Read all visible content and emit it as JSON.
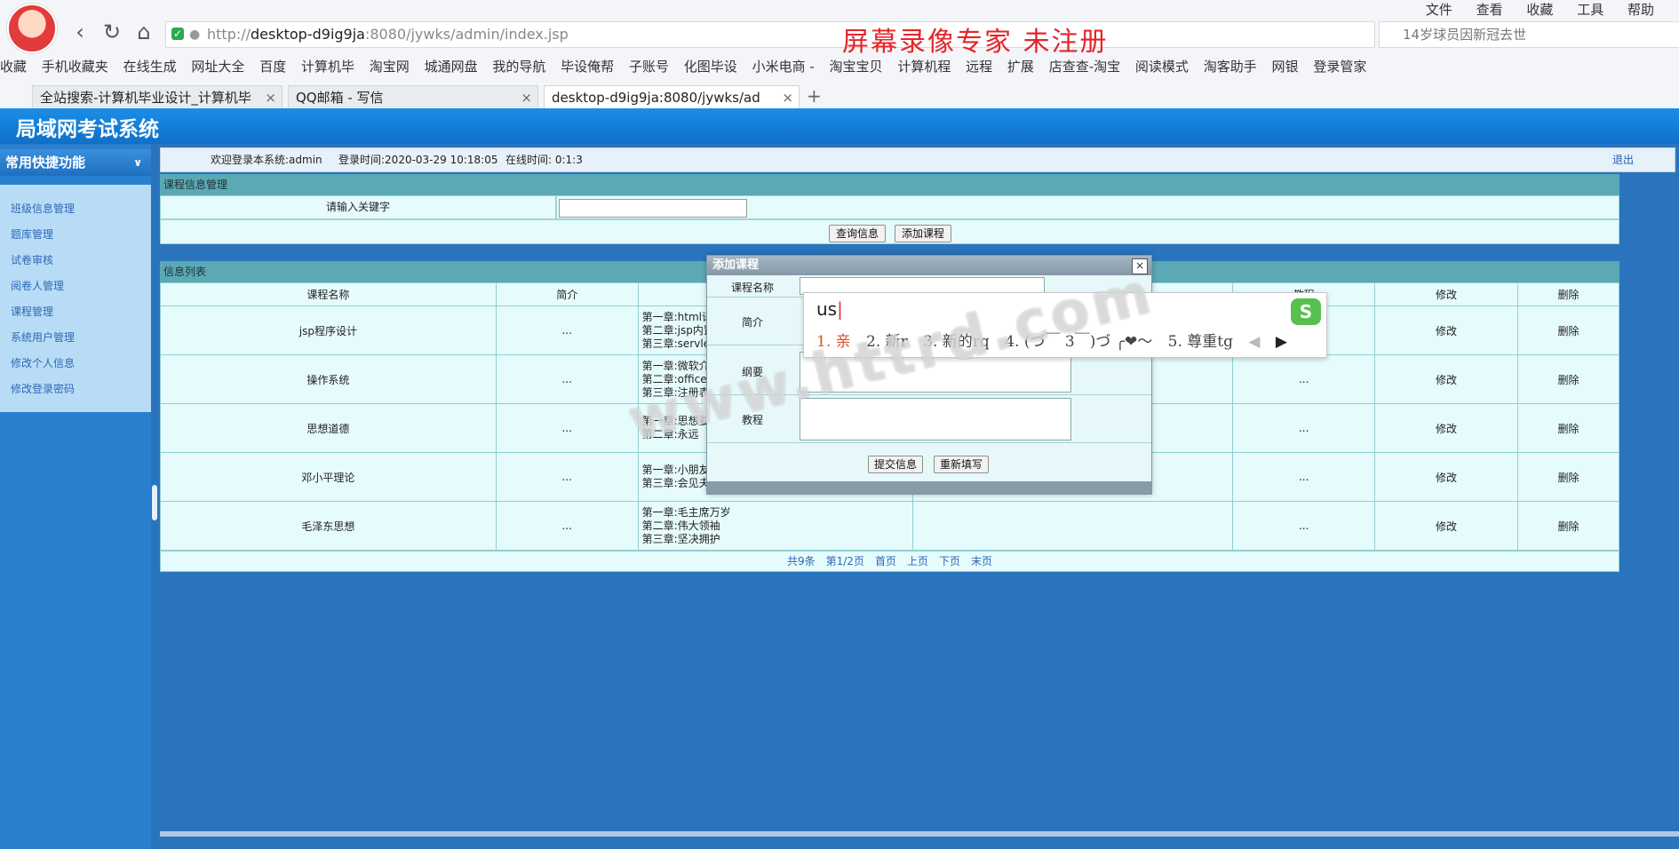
{
  "browser": {
    "url_prefix": "http://",
    "url_host": "desktop-d9ig9ja",
    "url_rest": ":8080/jywks/admin/index.jsp",
    "overlay_text": "屏幕录像专家  未注册",
    "menu": [
      "文件",
      "查看",
      "收藏",
      "工具",
      "帮助"
    ],
    "search_text": "14岁球员因新冠去世",
    "bookmarks": [
      "收藏",
      "手机收藏夹",
      "在线生成",
      "网址大全",
      "百度",
      "计算机毕",
      "淘宝网",
      "城通网盘",
      "我的导航",
      "毕设俺帮",
      "子账号",
      "化图毕设",
      "小米电商 -",
      "淘宝宝贝",
      "计算机程",
      "远程",
      "扩展",
      "店查查-淘宝",
      "阅读模式",
      "淘客助手",
      "网银",
      "登录管家"
    ],
    "tabs": [
      {
        "label": "全站搜索-计算机毕业设计_计算机毕"
      },
      {
        "label": "QQ邮箱 - 写信"
      },
      {
        "label": "desktop-d9ig9ja:8080/jywks/ad"
      }
    ]
  },
  "app": {
    "title": "局域网考试系统",
    "sidebar_title": "常用快捷功能",
    "sidebar_items": [
      "班级信息管理",
      "题库管理",
      "试卷审核",
      "阅卷人管理",
      "课程管理",
      "系统用户管理",
      "修改个人信息",
      "修改登录密码"
    ],
    "welcome": "欢迎登录本系统:admin",
    "login_time": "登录时间:2020-03-29 10:18:05",
    "online_time": "在线时间: 0:1:3",
    "logout": "退出"
  },
  "search_panel": {
    "title": "课程信息管理",
    "keyword_label": "请输入关键字",
    "keyword_value": "",
    "query_button": "查询信息",
    "add_button": "添加课程"
  },
  "list": {
    "title": "信息列表",
    "columns": [
      "课程名称",
      "简介",
      "",
      "",
      "教程",
      "修改",
      "删除"
    ],
    "rows": [
      {
        "name": "jsp程序设计",
        "intro": "...",
        "outline": [
          "第一章:html语",
          "第二章:jsp内置",
          "第三章:servle"
        ],
        "tutorial": "...",
        "edit": "修改",
        "delete": "删除"
      },
      {
        "name": "操作系统",
        "intro": "...",
        "outline": [
          "第一章:微软介",
          "第二章:office",
          "第三章:注册表"
        ],
        "tutorial": "...",
        "edit": "修改",
        "delete": "删除"
      },
      {
        "name": "思想道德",
        "intro": "...",
        "outline": [
          "第一章:思想要",
          "第二章:永远"
        ],
        "tutorial": "...",
        "edit": "修改",
        "delete": "删除"
      },
      {
        "name": "邓小平理论",
        "intro": "...",
        "outline": [
          "第一章:小朋友",
          "第三章:会见夫"
        ],
        "tutorial": "...",
        "edit": "修改",
        "delete": "删除"
      },
      {
        "name": "毛泽东思想",
        "intro": "...",
        "outline": [
          "第一章:毛主席万岁",
          "第二章:伟大领袖",
          "第三章:坚决拥护"
        ],
        "tutorial": "...",
        "edit": "修改",
        "delete": "删除"
      }
    ],
    "pager": [
      "共9条",
      "第1/2页",
      "首页",
      "上页",
      "下页",
      "末页"
    ]
  },
  "dialog": {
    "title": "添加课程",
    "fields": [
      "课程名称",
      "简介",
      "纲要",
      "教程"
    ],
    "submit": "提交信息",
    "reset": "重新填写"
  },
  "ime": {
    "input": "us",
    "candidates": [
      "1. 亲",
      "2. 新r",
      "3. 新的rq",
      "4. (づ￣ 3￣)づ ╭❤～",
      "5. 尊重tg"
    ]
  },
  "watermark": "www.httrd.com"
}
